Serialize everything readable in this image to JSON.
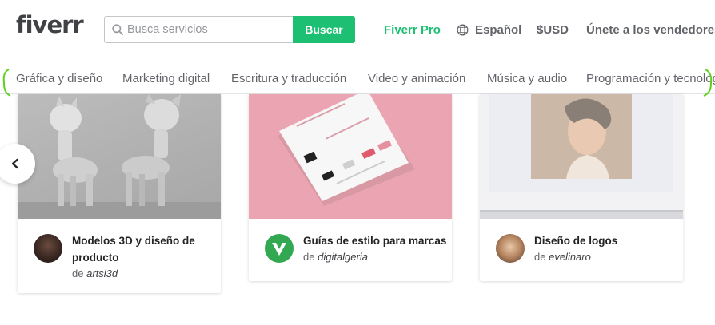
{
  "header": {
    "logo": "fiverr",
    "search_placeholder": "Busca servicios",
    "search_button": "Buscar",
    "nav": {
      "pro": "Fiverr Pro",
      "language": "Español",
      "currency": "$USD",
      "become_seller": "Únete a los vendedores"
    }
  },
  "categories": [
    "Gráfica y diseño",
    "Marketing digital",
    "Escritura y traducción",
    "Video y animación",
    "Música y audio",
    "Programación y tecnología"
  ],
  "cards": [
    {
      "title": "Modelos 3D y diseño de producto",
      "by_prefix": "de",
      "author": "artsi3d"
    },
    {
      "title": "Guías de estilo para marcas",
      "by_prefix": "de",
      "author": "digitalgeria"
    },
    {
      "title": "Diseño de logos",
      "by_prefix": "de",
      "author": "evelinaro"
    }
  ],
  "colors": {
    "brand_green": "#1dbf73",
    "highlight": "#5ed11f"
  }
}
